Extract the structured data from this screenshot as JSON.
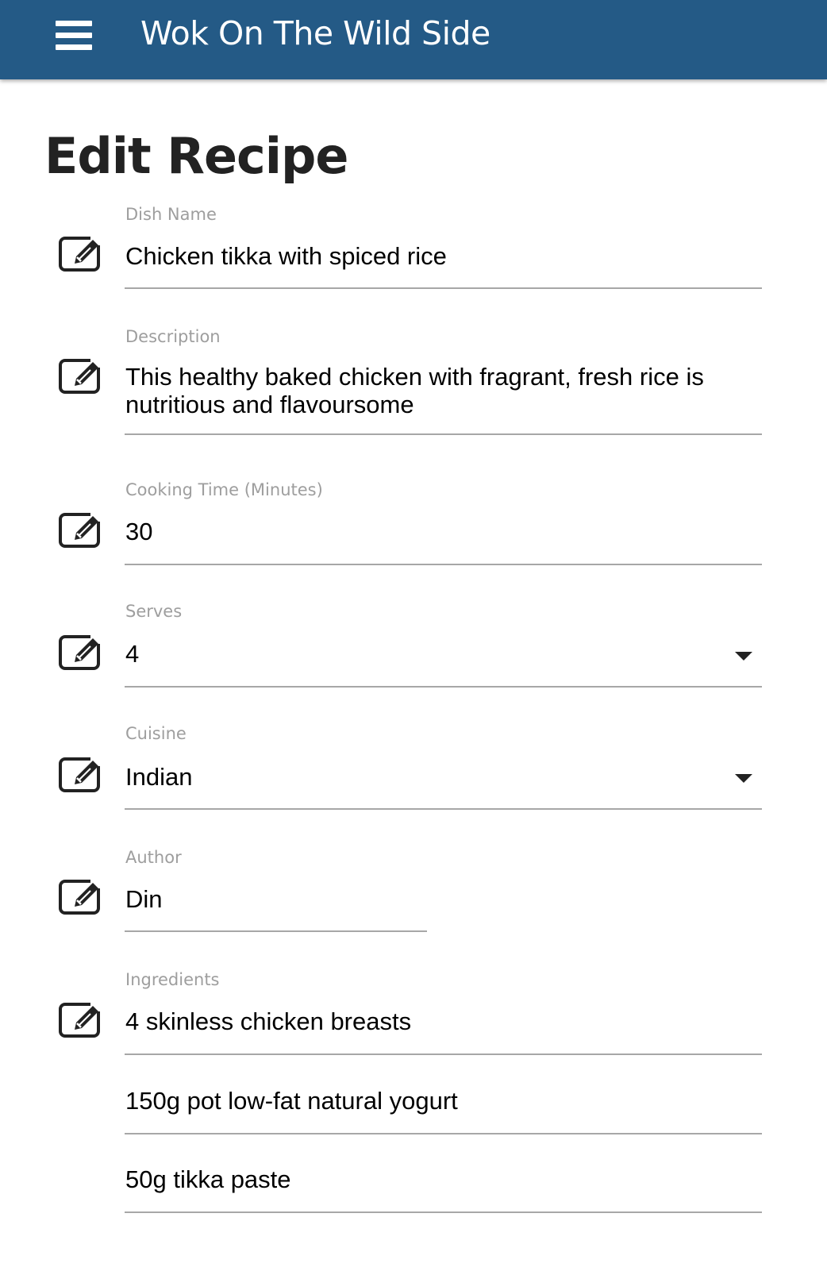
{
  "app_bar": {
    "title": "Wok On The Wild Side",
    "color": "#245a86",
    "menu_icon": "hamburger-menu-icon"
  },
  "page": {
    "title": "Edit Recipe"
  },
  "form": {
    "edit_icon": "pencil-square-icon",
    "dish_name": {
      "label": "Dish Name",
      "value": "Chicken tikka with spiced rice"
    },
    "description": {
      "label": "Description",
      "value_line1": "This healthy baked chicken with fragrant, fresh rice is",
      "value_line2": "nutritious and flavoursome"
    },
    "cooking_time": {
      "label": "Cooking Time (Minutes)",
      "value": "30"
    },
    "serves": {
      "label": "Serves",
      "value": "4"
    },
    "cuisine": {
      "label": "Cuisine",
      "value": "Indian"
    },
    "author": {
      "label": "Author",
      "value": "Din"
    },
    "ingredients": {
      "label": "Ingredients",
      "items": [
        "4 skinless chicken breasts",
        "150g pot low-fat natural yogurt",
        "50g tikka paste"
      ]
    }
  }
}
